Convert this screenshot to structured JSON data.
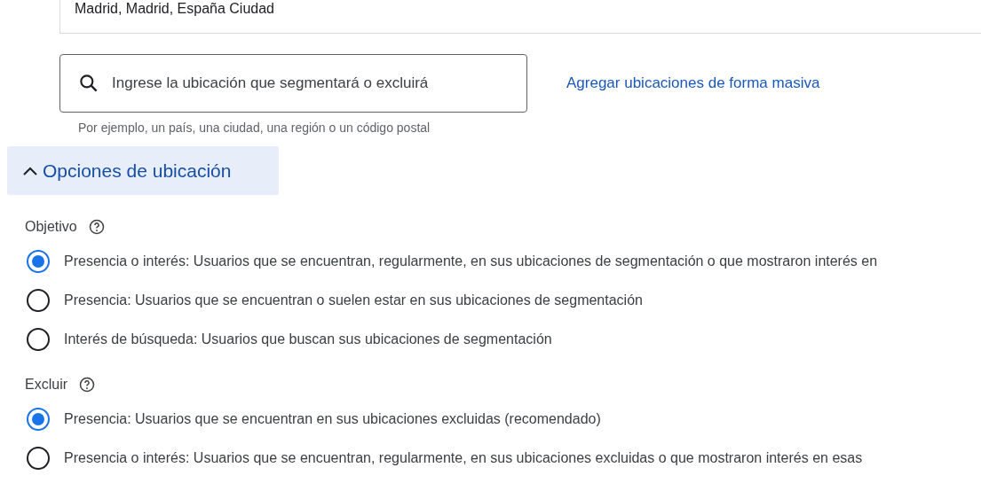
{
  "location_field": {
    "value": "Madrid, Madrid, España Ciudad"
  },
  "search": {
    "placeholder": "Ingrese la ubicación que segmentará o excluirá",
    "hint": "Por ejemplo, un país, una ciudad, una región o un código postal"
  },
  "bulk_link": "Agregar ubicaciones de forma masiva",
  "options_toggle": {
    "label": "Opciones de ubicación",
    "expanded": true
  },
  "groups": [
    {
      "label": "Objetivo",
      "options": [
        {
          "label": "Presencia o interés: Usuarios que se encuentran, regularmente, en sus ubicaciones de segmentación o que mostraron interés en",
          "selected": true
        },
        {
          "label": "Presencia: Usuarios que se encuentran o suelen estar en sus ubicaciones de segmentación",
          "selected": false
        },
        {
          "label": "Interés de búsqueda: Usuarios que buscan sus ubicaciones de segmentación",
          "selected": false
        }
      ]
    },
    {
      "label": "Excluir",
      "options": [
        {
          "label": "Presencia: Usuarios que se encuentran en sus ubicaciones excluidas (recomendado)",
          "selected": true
        },
        {
          "label": "Presencia o interés: Usuarios que se encuentran, regularmente, en sus ubicaciones excluidas o que mostraron interés en esas",
          "selected": false
        }
      ]
    }
  ]
}
